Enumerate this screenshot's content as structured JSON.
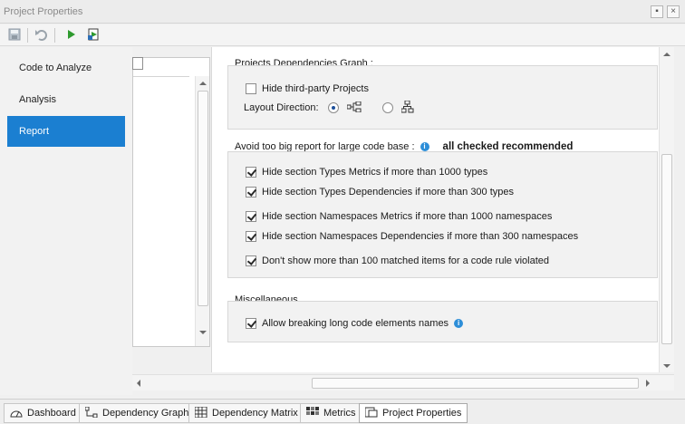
{
  "window": {
    "title": "Project Properties"
  },
  "nav": {
    "items": [
      {
        "label": "Code to Analyze"
      },
      {
        "label": "Analysis"
      },
      {
        "label": "Report"
      }
    ]
  },
  "graph_section": {
    "title": "Projects Dependencies Graph :",
    "hide_third_party_label": "Hide third-party Projects",
    "layout_direction_label": "Layout Direction:"
  },
  "report_section": {
    "title": "Avoid too big report for large code base :",
    "hint": "all checked recommended",
    "options": [
      {
        "label": "Hide section Types Metrics if more than 1000 types"
      },
      {
        "label": "Hide section Types Dependencies if more than 300 types"
      },
      {
        "label": "Hide section Namespaces Metrics if more than 1000 namespaces"
      },
      {
        "label": "Hide section Namespaces Dependencies if more than 300 namespaces"
      },
      {
        "label": "Don't show more than 100 matched items for a code rule violated"
      }
    ]
  },
  "misc_section": {
    "title": "Miscellaneous",
    "allow_breaking_label": "Allow breaking long code elements names"
  },
  "tabs": [
    {
      "label": "Dashboard"
    },
    {
      "label": "Dependency Graph"
    },
    {
      "label": "Dependency Matrix"
    },
    {
      "label": "Metrics"
    },
    {
      "label": "Project Properties"
    }
  ]
}
